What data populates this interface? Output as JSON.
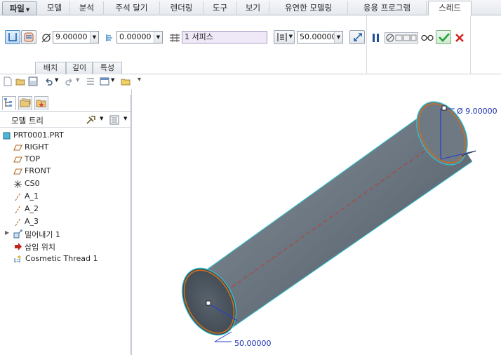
{
  "ribbon": {
    "tabs": [
      {
        "label": "파일"
      },
      {
        "label": "모델"
      },
      {
        "label": "분석"
      },
      {
        "label": "주석 달기"
      },
      {
        "label": "렌더링"
      },
      {
        "label": "도구"
      },
      {
        "label": "보기"
      },
      {
        "label": "유연한 모델링"
      },
      {
        "label": "응용 프로그램"
      },
      {
        "label": "스레드"
      }
    ],
    "active_tab": "스레드"
  },
  "dashboard": {
    "diameter_value": "9.00000",
    "pitch_value": "0.00000",
    "thread_series_value": "1 서피스",
    "depth_value": "50.00000",
    "subtabs": [
      {
        "label": "배치"
      },
      {
        "label": "깊이"
      },
      {
        "label": "특성"
      }
    ],
    "accent_color": "#2a9fd6",
    "ok_color": "#23a23a",
    "cancel_color": "#d42323"
  },
  "navigator": {
    "title": "모델 트리",
    "items": [
      {
        "label": "PRT0001.PRT",
        "icon": "part-icon"
      },
      {
        "label": "RIGHT",
        "icon": "datum-plane-icon"
      },
      {
        "label": "TOP",
        "icon": "datum-plane-icon"
      },
      {
        "label": "FRONT",
        "icon": "datum-plane-icon"
      },
      {
        "label": "CS0",
        "icon": "coordinate-system-icon"
      },
      {
        "label": "A_1",
        "icon": "datum-axis-icon"
      },
      {
        "label": "A_2",
        "icon": "datum-axis-icon"
      },
      {
        "label": "A_3",
        "icon": "datum-axis-icon"
      },
      {
        "label": "밀어내기 1",
        "icon": "extrude-icon"
      },
      {
        "label": "삽입 위치",
        "icon": "insert-here-arrow-icon"
      },
      {
        "label": "Cosmetic Thread 1",
        "icon": "cosmetic-thread-icon"
      }
    ]
  },
  "graphics": {
    "diameter_dim_label": "Ø 9.00000",
    "depth_dim_label": "50.00000",
    "body_color": "#5f6d7a",
    "edge_color": "#c87020",
    "axis_color": "#c0392b"
  }
}
